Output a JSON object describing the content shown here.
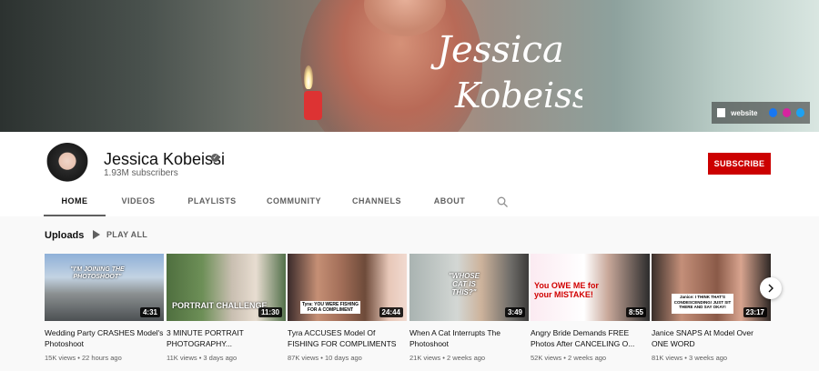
{
  "banner": {
    "signature_line1": "Jessica",
    "signature_line2": "Kobeissi",
    "links": {
      "website_label": "website",
      "social_icons": [
        "facebook-icon",
        "instagram-icon",
        "twitter-icon"
      ]
    }
  },
  "channel": {
    "name": "Jessica Kobeissi",
    "subscribers": "1.93M subscribers",
    "subscribe_label": "SUBSCRIBE",
    "verified_glyph": "✓"
  },
  "tabs": [
    {
      "label": "HOME",
      "active": true
    },
    {
      "label": "VIDEOS",
      "active": false
    },
    {
      "label": "PLAYLISTS",
      "active": false
    },
    {
      "label": "COMMUNITY",
      "active": false
    },
    {
      "label": "CHANNELS",
      "active": false
    },
    {
      "label": "ABOUT",
      "active": false
    }
  ],
  "uploads": {
    "title": "Uploads",
    "play_all_label": "PLAY ALL",
    "videos": [
      {
        "title": "Wedding Party CRASHES Model's Photoshoot",
        "meta": "15K views • 22 hours ago",
        "duration": "4:31",
        "thumb_text": "\"I'M JOINING THE PHOTOSHOOT\""
      },
      {
        "title": "3 MINUTE PORTRAIT PHOTOGRAPHY...",
        "meta": "11K views • 3 days ago",
        "duration": "11:30",
        "thumb_text": "PORTRAIT CHALLENGE"
      },
      {
        "title": "Tyra ACCUSES Model Of FISHING FOR COMPLIMENTS",
        "meta": "87K views • 10 days ago",
        "duration": "24:44",
        "thumb_text": "Tyra: YOU WERE FISHING FOR A COMPLIMENT"
      },
      {
        "title": "When A Cat Interrupts The Photoshoot",
        "meta": "21K views • 2 weeks ago",
        "duration": "3:49",
        "thumb_text": "\"WHOSE CAT IS THIS?\""
      },
      {
        "title": "Angry Bride Demands FREE Photos After CANCELING O...",
        "meta": "52K views • 2 weeks ago",
        "duration": "8:55",
        "thumb_text": "You OWE ME for your MISTAKE!"
      },
      {
        "title": "Janice SNAPS At Model Over ONE WORD",
        "meta": "81K views • 3 weeks ago",
        "duration": "23:17",
        "thumb_text": "Janice: I THINK THAT'S CONDESCENDING! JUST SIT THERE AND SAY OKAY!"
      }
    ]
  },
  "colors": {
    "subscribe": "#cc0000",
    "text_primary": "#0f0f0f",
    "text_secondary": "#606060",
    "background": "#f9f9f9"
  }
}
